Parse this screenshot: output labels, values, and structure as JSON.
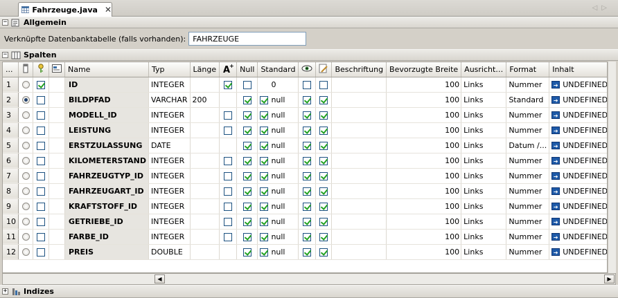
{
  "tab": {
    "title": "Fahrzeuge.java",
    "close": "✕"
  },
  "nav": {
    "prev": "◁",
    "next": "▷"
  },
  "sections": {
    "general": {
      "title": "Allgemein",
      "toggle": "−"
    },
    "columns": {
      "title": "Spalten",
      "toggle": "−"
    },
    "indexes": {
      "title": "Indizes",
      "toggle": "+"
    }
  },
  "assoc": {
    "label": "Verknüpfte Datenbanktabelle (falls vorhanden):",
    "value": "FAHRZEUGE"
  },
  "headers": {
    "rownum": "...",
    "pk_icon": "column-icon",
    "key_icon": "key-icon",
    "fk_icon": "table-link-icon",
    "name": "Name",
    "type": "Typ",
    "length": "Länge",
    "auto_icon": "auto-increment-icon",
    "null": "Null",
    "default": "Standard",
    "visible_icon": "eye-icon",
    "edit_icon": "edit-icon",
    "caption": "Beschriftung",
    "pref_width": "Bevorzugte Breite",
    "align": "Ausricht…",
    "format": "Format",
    "content": "Inhalt"
  },
  "rows": [
    {
      "n": "1",
      "pk": false,
      "key": true,
      "name": "ID",
      "type": "INTEGER",
      "length": "",
      "auto": true,
      "null": false,
      "def_cb": false,
      "default": "0",
      "vis": false,
      "edit": false,
      "width": "100",
      "align": "Links",
      "format": "Nummer",
      "content": "UNDEFINED"
    },
    {
      "n": "2",
      "pk": true,
      "key": false,
      "name": "BILDPFAD",
      "type": "VARCHAR",
      "length": "200",
      "auto": null,
      "null": true,
      "def_cb": true,
      "default": "null",
      "vis": true,
      "edit": true,
      "width": "100",
      "align": "Links",
      "format": "Standard",
      "content": "UNDEFINED"
    },
    {
      "n": "3",
      "pk": false,
      "key": false,
      "name": "MODELL_ID",
      "type": "INTEGER",
      "length": "",
      "auto": false,
      "null": true,
      "def_cb": true,
      "default": "null",
      "vis": true,
      "edit": true,
      "width": "100",
      "align": "Links",
      "format": "Nummer",
      "content": "UNDEFINED"
    },
    {
      "n": "4",
      "pk": false,
      "key": false,
      "name": "LEISTUNG",
      "type": "INTEGER",
      "length": "",
      "auto": false,
      "null": true,
      "def_cb": true,
      "default": "null",
      "vis": true,
      "edit": true,
      "width": "100",
      "align": "Links",
      "format": "Nummer",
      "content": "UNDEFINED"
    },
    {
      "n": "5",
      "pk": false,
      "key": false,
      "name": "ERSTZULASSUNG",
      "type": "DATE",
      "length": "",
      "auto": null,
      "null": true,
      "def_cb": true,
      "default": "null",
      "vis": true,
      "edit": true,
      "width": "100",
      "align": "Links",
      "format": "Datum /...",
      "content": "UNDEFINED"
    },
    {
      "n": "6",
      "pk": false,
      "key": false,
      "name": "KILOMETERSTAND",
      "type": "INTEGER",
      "length": "",
      "auto": false,
      "null": true,
      "def_cb": true,
      "default": "null",
      "vis": true,
      "edit": true,
      "width": "100",
      "align": "Links",
      "format": "Nummer",
      "content": "UNDEFINED"
    },
    {
      "n": "7",
      "pk": false,
      "key": false,
      "name": "FAHRZEUGTYP_ID",
      "type": "INTEGER",
      "length": "",
      "auto": false,
      "null": true,
      "def_cb": true,
      "default": "null",
      "vis": true,
      "edit": true,
      "width": "100",
      "align": "Links",
      "format": "Nummer",
      "content": "UNDEFINED"
    },
    {
      "n": "8",
      "pk": false,
      "key": false,
      "name": "FAHRZEUGART_ID",
      "type": "INTEGER",
      "length": "",
      "auto": false,
      "null": true,
      "def_cb": true,
      "default": "null",
      "vis": true,
      "edit": true,
      "width": "100",
      "align": "Links",
      "format": "Nummer",
      "content": "UNDEFINED"
    },
    {
      "n": "9",
      "pk": false,
      "key": false,
      "name": "KRAFTSTOFF_ID",
      "type": "INTEGER",
      "length": "",
      "auto": false,
      "null": true,
      "def_cb": true,
      "default": "null",
      "vis": true,
      "edit": true,
      "width": "100",
      "align": "Links",
      "format": "Nummer",
      "content": "UNDEFINED"
    },
    {
      "n": "10",
      "pk": false,
      "key": false,
      "name": "GETRIEBE_ID",
      "type": "INTEGER",
      "length": "",
      "auto": false,
      "null": true,
      "def_cb": true,
      "default": "null",
      "vis": true,
      "edit": true,
      "width": "100",
      "align": "Links",
      "format": "Nummer",
      "content": "UNDEFINED"
    },
    {
      "n": "11",
      "pk": false,
      "key": false,
      "name": "FARBE_ID",
      "type": "INTEGER",
      "length": "",
      "auto": false,
      "null": true,
      "def_cb": true,
      "default": "null",
      "vis": true,
      "edit": true,
      "width": "100",
      "align": "Links",
      "format": "Nummer",
      "content": "UNDEFINED"
    },
    {
      "n": "12",
      "pk": false,
      "key": false,
      "name": "PREIS",
      "type": "DOUBLE",
      "length": "",
      "auto": null,
      "null": true,
      "def_cb": true,
      "default": "null",
      "vis": true,
      "edit": true,
      "width": "100",
      "align": "Links",
      "format": "Nummer",
      "content": "UNDEFINED"
    }
  ],
  "scroll": {
    "left": "◀",
    "right": "▶"
  }
}
